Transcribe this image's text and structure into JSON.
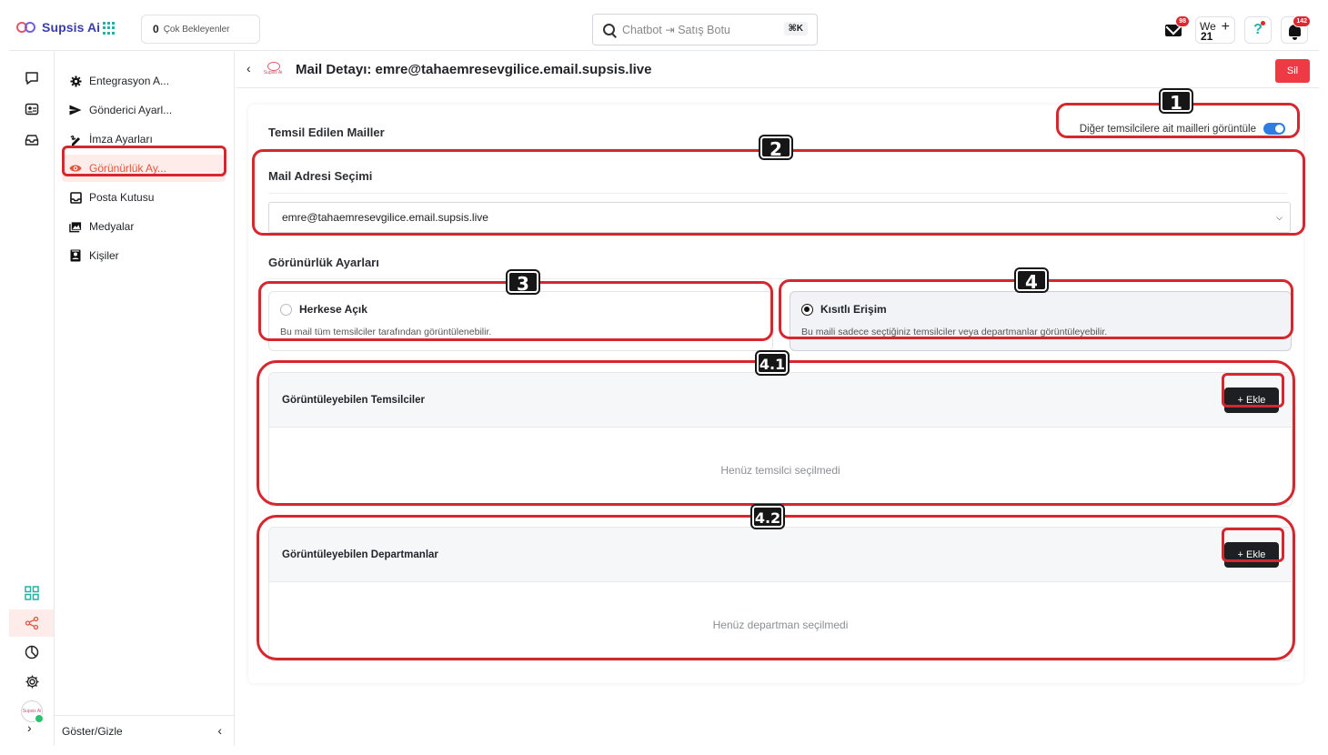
{
  "topbar": {
    "brand": "Supsis Ai",
    "pending_count": "0",
    "pending_label": "Çok Bekleyenler",
    "search_value": "Chatbot ⇥ Satış Botu",
    "search_shortcut": "⌘K",
    "mail_badge": "98",
    "week_label": "We",
    "week_day": "21",
    "bell_badge": "142",
    "icons": [
      "grid-apps-icon",
      "search-icon",
      "mail-icon",
      "add-icon",
      "help-icon",
      "bell-icon"
    ]
  },
  "rail": {
    "items": [
      "chat-icon",
      "contacts-icon",
      "inbox-icon",
      "dashboard-icon",
      "share-icon",
      "reports-icon",
      "settings-icon"
    ],
    "avatar_text": "Supsis Ai",
    "expand_glyph": "›"
  },
  "subnav": {
    "items": [
      {
        "label": "Entegrasyon A...",
        "icon": "gear-icon"
      },
      {
        "label": "Gönderici Ayarl...",
        "icon": "send-icon"
      },
      {
        "label": "İmza Ayarları",
        "icon": "signature-icon"
      },
      {
        "label": "Görünürlük Ay...",
        "icon": "eye-icon",
        "active": true
      },
      {
        "label": "Posta Kutusu",
        "icon": "inbox-icon"
      },
      {
        "label": "Medyalar",
        "icon": "media-icon"
      },
      {
        "label": "Kişiler",
        "icon": "contacts-icon"
      }
    ],
    "footer": "Göster/Gizle",
    "footer_chevron": "‹"
  },
  "page": {
    "back_glyph": "‹",
    "logo_text": "Supsis Ai",
    "title": "Mail Detayı: emre@tahaemresevgilice.email.supsis.live",
    "delete_label": "Sil"
  },
  "represented": {
    "title": "Temsil Edilen Mailler",
    "toggle_label": "Diğer temsilcilere ait mailleri görüntüle",
    "toggle_on": true
  },
  "mail_select": {
    "title": "Mail Adresi Seçimi",
    "value": "emre@tahaemresevgilice.email.supsis.live"
  },
  "visibility": {
    "title": "Görünürlük Ayarları",
    "open": {
      "label": "Herkese Açık",
      "desc": "Bu mail tüm temsilciler tarafından görüntülenebilir."
    },
    "restricted": {
      "label": "Kısıtlı Erişim",
      "desc": "Bu maili sadece seçtiğiniz temsilciler veya departmanlar görüntüleyebilir."
    },
    "selected": "restricted"
  },
  "agents": {
    "title": "Görüntüleyebilen Temsilciler",
    "add_label": "+ Ekle",
    "empty": "Henüz temsilci seçilmedi"
  },
  "departments": {
    "title": "Görüntüleyebilen Departmanlar",
    "add_label": "+ Ekle",
    "empty": "Henüz departman seçilmedi"
  },
  "annotations": [
    "1",
    "2",
    "3",
    "4",
    "4.1",
    "4.2"
  ],
  "colors": {
    "accent": "#e0563f",
    "highlight": "#d6262e",
    "toggle": "#2f7de1",
    "danger": "#ee3a45"
  }
}
